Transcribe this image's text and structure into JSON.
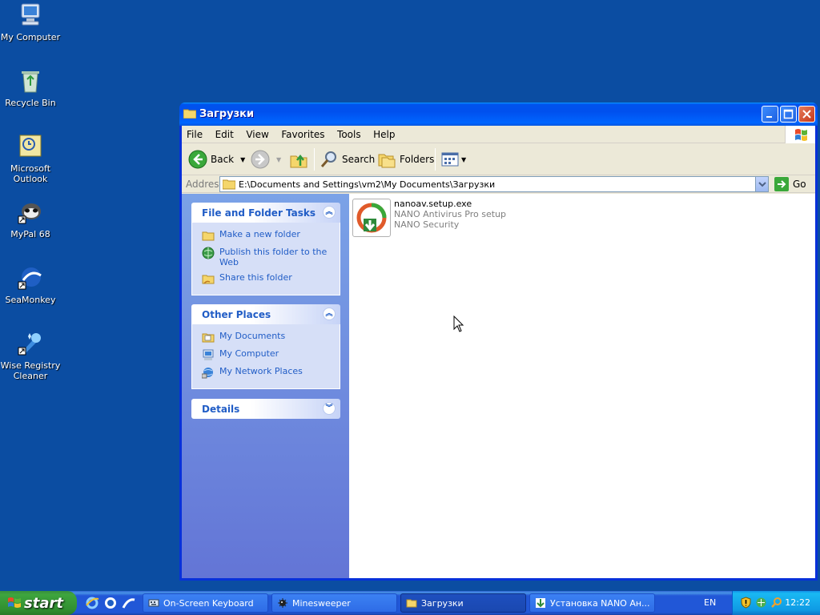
{
  "desktop": {
    "icons": [
      {
        "label": "My Computer",
        "icon": "computer-icon"
      },
      {
        "label": "Recycle Bin",
        "icon": "recycle-bin-icon"
      },
      {
        "label": "Microsoft Outlook",
        "icon": "outlook-icon"
      },
      {
        "label": "MyPal 68",
        "icon": "mypal-icon"
      },
      {
        "label": "SeaMonkey",
        "icon": "seamonkey-icon"
      },
      {
        "label": "Wise Registry Cleaner",
        "icon": "registry-cleaner-icon"
      }
    ]
  },
  "window": {
    "title": "Загрузки",
    "menu": [
      "File",
      "Edit",
      "View",
      "Favorites",
      "Tools",
      "Help"
    ],
    "toolbar": {
      "back": "Back",
      "search": "Search",
      "folders": "Folders"
    },
    "address": {
      "label": "Address",
      "value": "E:\\Documents and Settings\\vm2\\My Documents\\Загрузки",
      "go": "Go"
    },
    "tasks": {
      "file_folder": {
        "title": "File and Folder Tasks",
        "items": [
          "Make a new folder",
          "Publish this folder to the Web",
          "Share this folder"
        ]
      },
      "other_places": {
        "title": "Other Places",
        "items": [
          "My Documents",
          "My Computer",
          "My Network Places"
        ]
      },
      "details": {
        "title": "Details"
      }
    },
    "files": [
      {
        "name": "nanoav.setup.exe",
        "description": "NANO Antivirus Pro setup",
        "company": "NANO Security",
        "icon": "nano-installer-icon"
      }
    ]
  },
  "taskbar": {
    "start": "start",
    "tasks": [
      {
        "label": "On-Screen Keyboard",
        "icon": "keyboard-icon"
      },
      {
        "label": "Minesweeper",
        "icon": "mine-icon"
      },
      {
        "label": "Загрузки",
        "icon": "folder-icon",
        "active": true
      },
      {
        "label": "Установка NANO Ан...",
        "icon": "installer-icon"
      }
    ],
    "language": "EN",
    "clock": "12:22"
  },
  "colors": {
    "desktop": "#0b4da2",
    "titlebar": "#0050ee",
    "taskpane_link": "#215dc6",
    "start_button": "#3ea53e"
  }
}
